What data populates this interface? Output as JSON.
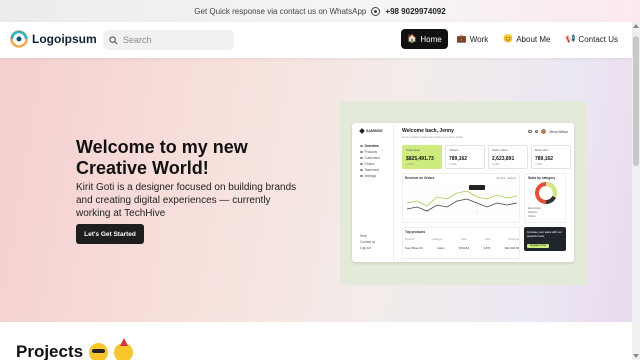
{
  "topbar": {
    "message": "Get Quick response via contact us on WhatsApp",
    "phone": "+98 9029974092",
    "icon": "whatsapp-icon"
  },
  "header": {
    "logo_text": "Logoipsum",
    "search_placeholder": "Search",
    "nav": [
      {
        "label": "Home",
        "icon": "house",
        "active": true
      },
      {
        "label": "Work",
        "icon": "briefcase"
      },
      {
        "label": "About Me",
        "icon": "smiley"
      },
      {
        "label": "Contact Us",
        "icon": "megaphone"
      }
    ]
  },
  "hero": {
    "title": "Welcome to my new Creative World!",
    "description": "Kirit Goti is a designer focused on building brands and creating digital experiences — currently working at TechHive",
    "cta_label": "Let's Get Started"
  },
  "preview": {
    "brand": "SAMWISE",
    "menu": [
      "Overview",
      "Products",
      "Customers",
      "Orders",
      "Statement",
      "Settings"
    ],
    "help": [
      "Help",
      "Contact us",
      "Log out"
    ],
    "greeting": "Welcome back, Jenny",
    "subtitle": "Here's what's happening with your store today",
    "user": "Jenny Wilson",
    "stats": [
      {
        "label": "Total sales",
        "value": "$825,491.73",
        "change": "+1.2%"
      },
      {
        "label": "Visitors",
        "value": "789,162",
        "change": "+1.2%"
      },
      {
        "label": "Total orders",
        "value": "2,623,891",
        "change": "+1.2%"
      },
      {
        "label": "Refunded",
        "value": "789,162",
        "change": "+1.2%"
      }
    ],
    "chart_title": "Revenue on Orders",
    "chart_controls": "All time  ·  Export",
    "category_title": "Sales by category",
    "category_legend": [
      "Electronics",
      "Fashion",
      "Others"
    ],
    "products_title": "Top products",
    "products_head": [
      "Product",
      "Category",
      "Price",
      "Sold",
      "Revenue"
    ],
    "products_row": [
      "Sony Bose Kit",
      "Audio",
      "$734.82",
      "3,871",
      "$21,318.00"
    ],
    "promo_text": "Increase your sales with our powerful tools",
    "promo_button": "Upgrade to Pro",
    "colors": {
      "accent": "#cdeb7f",
      "dark": "#20252b"
    }
  },
  "projects": {
    "title": "Projects"
  }
}
